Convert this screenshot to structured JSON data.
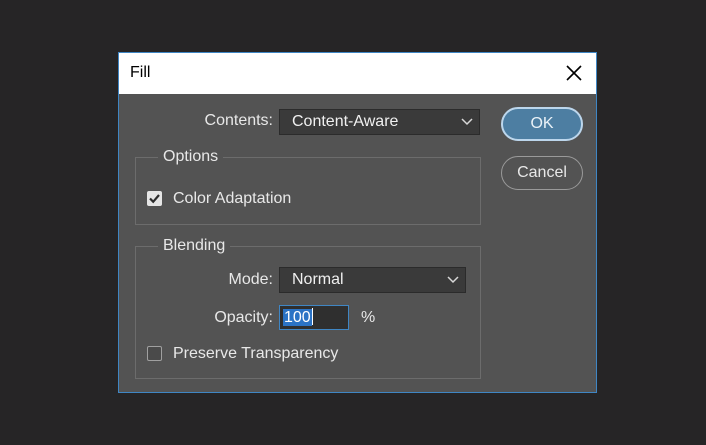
{
  "dialog": {
    "title": "Fill",
    "close_icon": "close-icon"
  },
  "contents": {
    "label": "Contents:",
    "value": "Content-Aware"
  },
  "options": {
    "legend": "Options",
    "color_adaptation": {
      "label": "Color Adaptation",
      "checked": true
    }
  },
  "blending": {
    "legend": "Blending",
    "mode": {
      "label": "Mode:",
      "value": "Normal"
    },
    "opacity": {
      "label": "Opacity:",
      "value": "100",
      "unit": "%"
    },
    "preserve_transparency": {
      "label": "Preserve Transparency",
      "checked": false
    }
  },
  "buttons": {
    "ok": "OK",
    "cancel": "Cancel"
  },
  "colors": {
    "accent": "#3f86c4",
    "dialog_bg": "#535353",
    "backdrop": "#262526"
  }
}
